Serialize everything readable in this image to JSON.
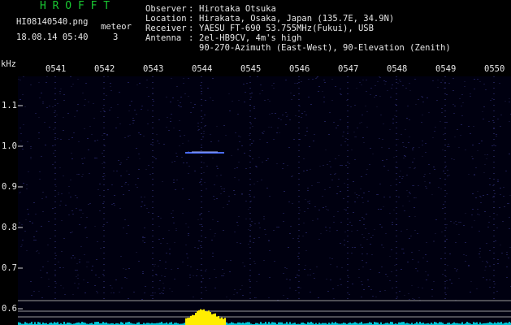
{
  "header": {
    "app_title": "H R O F F T",
    "filename": "HI08140540.png",
    "datetime": "18.08.14 05:40",
    "meteor_label": "meteor",
    "meteor_count": "3"
  },
  "station": [
    {
      "key": "Observer",
      "value": "Hirotaka Otsuka"
    },
    {
      "key": "Location",
      "value": "Hirakata, Osaka, Japan (135.7E, 34.9N)"
    },
    {
      "key": "Receiver",
      "value": "YAESU FT-690 53.755MHz(Fukui), USB"
    },
    {
      "key": "Antenna",
      "value": "2el-HB9CV, 4m's high"
    },
    {
      "key": "",
      "value": "90-270-Azimuth (East-West), 90-Elevation (Zenith)"
    }
  ],
  "axis": {
    "y_unit": "kHz",
    "y_ticks": [
      "1.1",
      "1.0",
      "0.9",
      "0.8",
      "0.7",
      "0.6"
    ],
    "x_ticks": [
      "0541",
      "0542",
      "0543",
      "0544",
      "0545",
      "0546",
      "0547",
      "0548",
      "0549",
      "0550"
    ]
  },
  "colors": {
    "title": "#19c832",
    "background": "#000010",
    "echo": "#4a6cff",
    "signal_trace": "#ffee00",
    "noise_trace": "#00c8d8",
    "grid_line": "#9a9a9a"
  }
}
